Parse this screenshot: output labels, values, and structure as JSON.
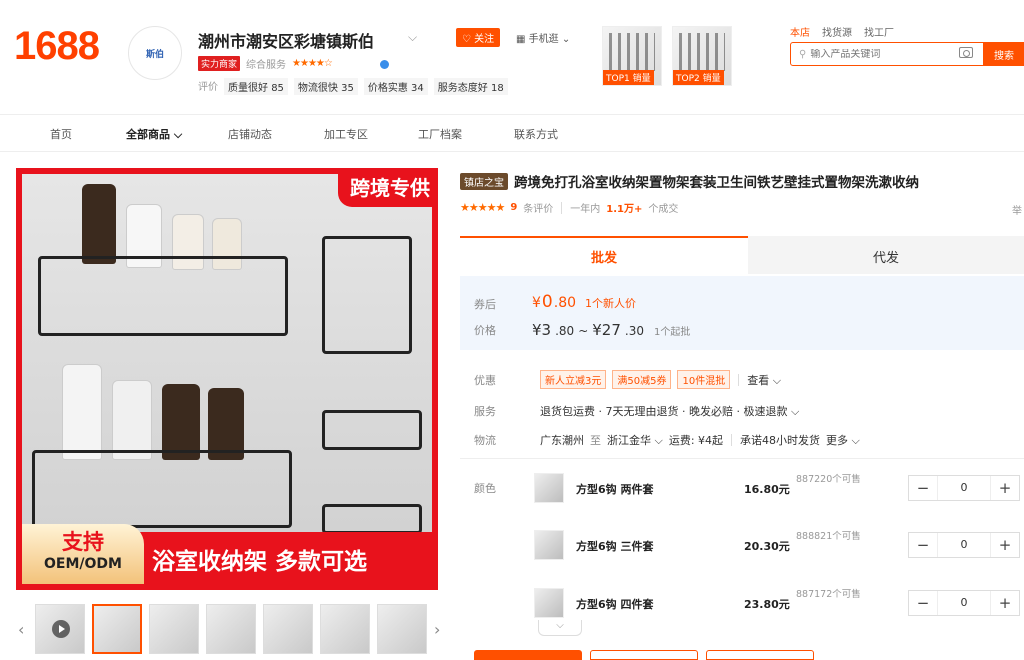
{
  "header": {
    "logo": "1688",
    "shop_logo_text": "斯伯",
    "shop_name": "潮州市潮安区彩塘镇斯伯",
    "follow_label": "关注",
    "mobile_label": "手机逛",
    "badge": "实力商家",
    "composite_label": "综合服务",
    "composite_stars": "★★★★☆",
    "rating_label": "评价",
    "ratings": [
      {
        "label": "质量很好",
        "count": "85"
      },
      {
        "label": "物流很快",
        "count": "35"
      },
      {
        "label": "价格实惠",
        "count": "34"
      },
      {
        "label": "服务态度好",
        "count": "18"
      }
    ],
    "top_products": [
      {
        "tag": "TOP1 销量"
      },
      {
        "tag": "TOP2 销量"
      }
    ],
    "search_tabs": [
      "本店",
      "找货源",
      "找工厂"
    ],
    "search_placeholder": "输入产品关键词",
    "search_button": "搜索"
  },
  "nav": [
    "首页",
    "全部商品",
    "店铺动态",
    "加工专区",
    "工厂档案",
    "联系方式"
  ],
  "gallery": {
    "corner_tag": "跨境专供",
    "banner_text": "浴室收纳架 多款可选",
    "oem_big": "支持",
    "oem_small": "OEM/ODM",
    "thumb_count": 7
  },
  "product": {
    "store_badge": "镇店之宝",
    "title": "跨境免打孔浴室收纳架置物架套装卫生间铁艺壁挂式置物架洗漱收纳",
    "review_count": "9",
    "review_label": "条评价",
    "year_label": "一年内",
    "sold": "1.1万+",
    "sold_label": "个成交",
    "right_edge_char": "举"
  },
  "tabs": {
    "wholesale": "批发",
    "dropship": "代发"
  },
  "price": {
    "after_coupon_label": "券后",
    "after_coupon_symbol": "¥",
    "after_coupon_int": "0",
    "after_coupon_dec": ".80",
    "newcomer_note": "1个新人价",
    "price_label": "价格",
    "low_int": "¥3",
    "low_dec": ".80",
    "tilde": "~",
    "high_int": "¥27",
    "high_dec": ".30",
    "moq": "1个起批"
  },
  "discount": {
    "label": "优惠",
    "coupons": [
      "新人立减3元",
      "满50减5券",
      "10件混批"
    ],
    "view": "查看"
  },
  "service": {
    "label": "服务",
    "text": "退货包运费 · 7天无理由退货 · 晚发必赔 · 极速退款"
  },
  "logistics": {
    "label": "物流",
    "from": "广东潮州",
    "to_word": "至",
    "to": "浙江金华",
    "fee": "运费: ¥4起",
    "promise": "承诺48小时发货",
    "more": "更多"
  },
  "color_label": "颜色",
  "skus": [
    {
      "name": "方型6钩 两件套",
      "price": "16.80元",
      "stock": "887220个可售",
      "qty": "0"
    },
    {
      "name": "方型6钩 三件套",
      "price": "20.30元",
      "stock": "888821个可售",
      "qty": "0"
    },
    {
      "name": "方型6钩 四件套",
      "price": "23.80元",
      "stock": "887172个可售",
      "qty": "0"
    }
  ],
  "colors": {
    "accent": "#ff5000",
    "brand_red": "#e8121c",
    "price_bg": "#f1f6fd"
  }
}
